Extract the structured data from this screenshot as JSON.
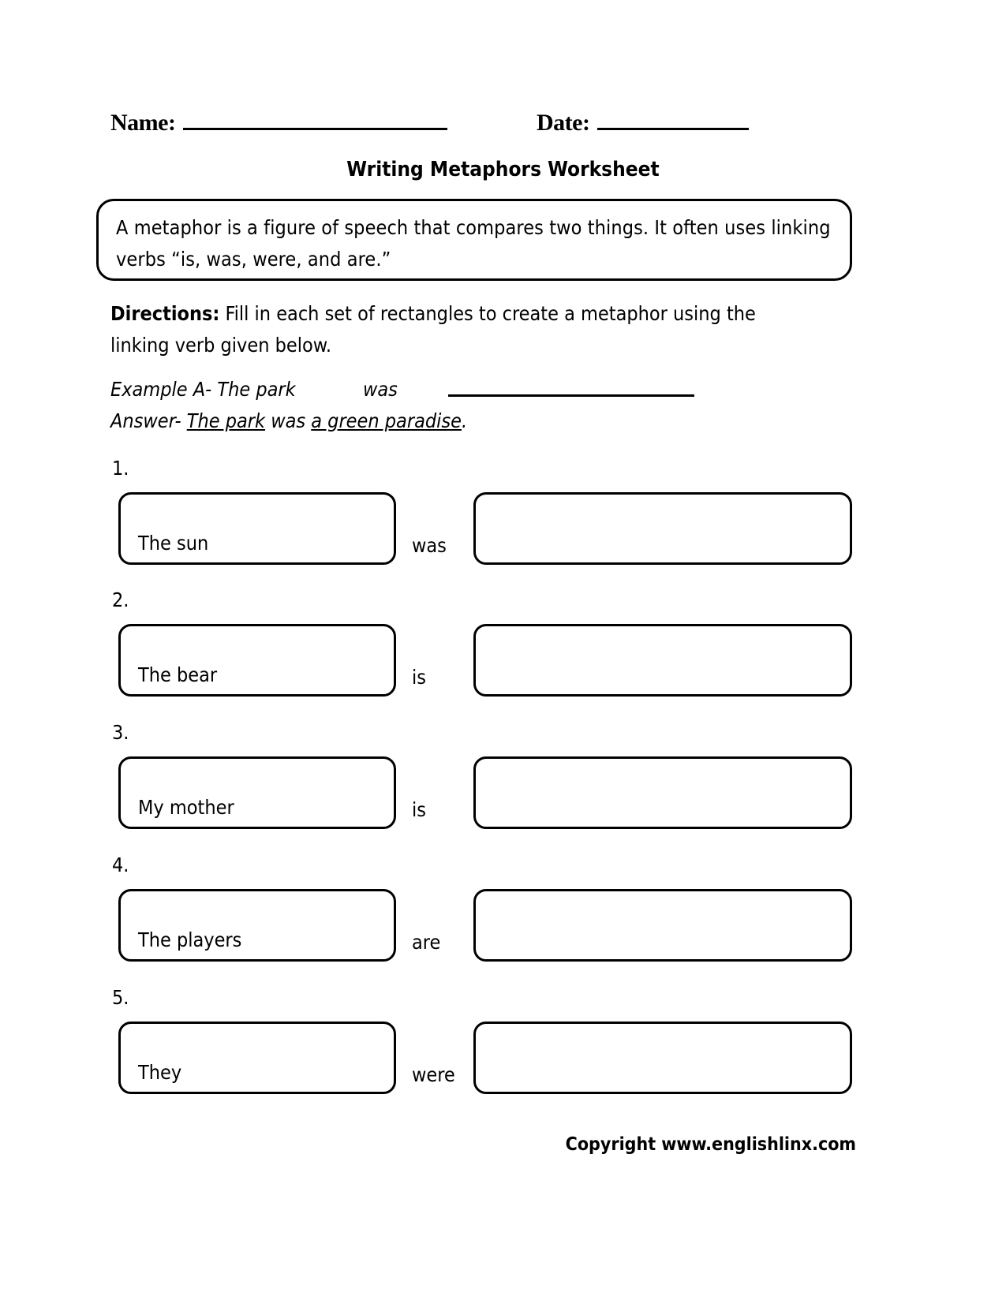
{
  "header": {
    "name_label": "Name:",
    "date_label": "Date:"
  },
  "title": "Writing Metaphors Worksheet",
  "definition": {
    "text": "A metaphor is a figure of speech that compares two things. It often uses linking verbs “is, was, were, and are.”"
  },
  "directions": {
    "label": "Directions:",
    "text": " Fill in each set of rectangles to create a metaphor using the linking verb given below."
  },
  "example": {
    "prompt_subject": "Example A- The park",
    "prompt_verb": "was",
    "answer_prefix": "Answer- ",
    "answer_subject": "The park",
    "answer_verb": " was ",
    "answer_complement": "a green paradise",
    "answer_period": "."
  },
  "questions": [
    {
      "number": "1.",
      "subject": "The sun",
      "verb": "was",
      "blank": ""
    },
    {
      "number": "2.",
      "subject": "The bear",
      "verb": "is",
      "blank": ""
    },
    {
      "number": "3.",
      "subject": "My mother",
      "verb": "is",
      "blank": ""
    },
    {
      "number": "4.",
      "subject": "The players",
      "verb": "are",
      "blank": ""
    },
    {
      "number": "5.",
      "subject": "They",
      "verb": "were",
      "blank": ""
    }
  ],
  "footer": {
    "copyright": "Copyright www.englishlinx.com"
  },
  "colors": {
    "ink": "#000000",
    "paper": "#ffffff"
  }
}
